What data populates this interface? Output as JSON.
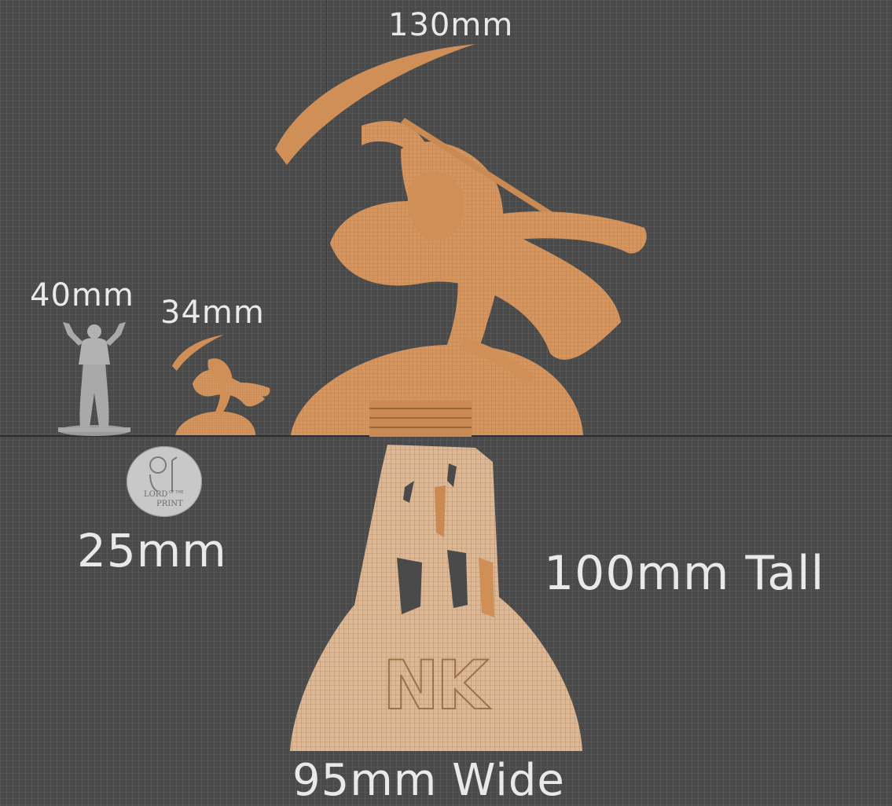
{
  "measurements": {
    "main_height": "130mm",
    "reference_40": "40mm",
    "reference_34": "34mm",
    "base_diameter": "25mm",
    "display_base_height": "100mm Tall",
    "display_base_width": "95mm Wide"
  },
  "logo": {
    "line1": "LORD",
    "line2": "OF THE",
    "line3": "PRINT"
  },
  "base_engraving": "NK",
  "colors": {
    "background": "#4a4a4a",
    "grid": "#555555",
    "resin": "#d4955f",
    "resin_light": "#dcb896",
    "reference_grey": "#a9a9a9",
    "label_text": "#e9e9e9"
  }
}
